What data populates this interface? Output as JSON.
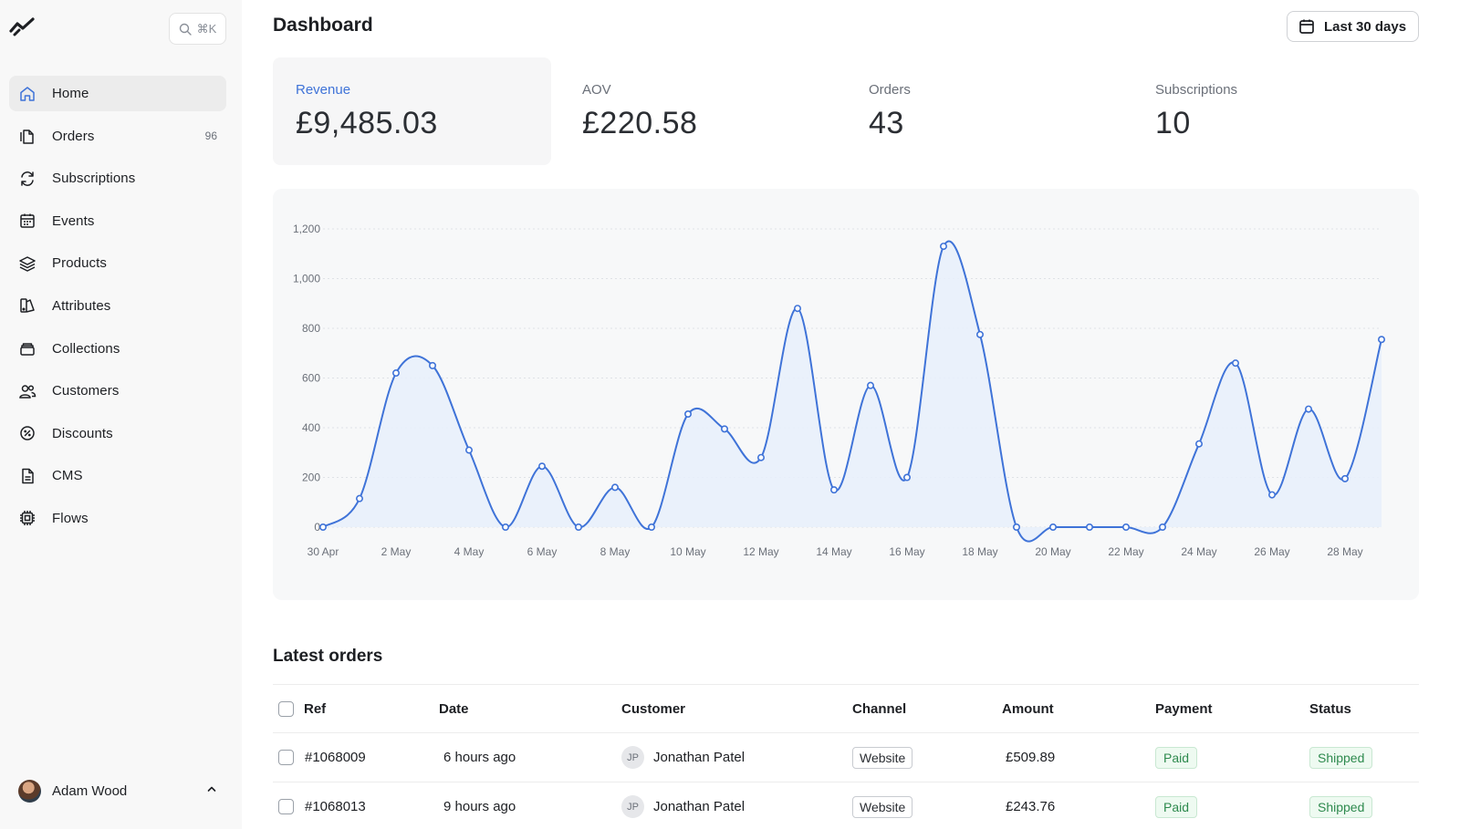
{
  "sidebar": {
    "search_shortcut": "⌘K",
    "items": [
      {
        "label": "Home",
        "icon": "home-icon",
        "active": true
      },
      {
        "label": "Orders",
        "icon": "orders-icon",
        "badge": "96"
      },
      {
        "label": "Subscriptions",
        "icon": "refresh-icon"
      },
      {
        "label": "Events",
        "icon": "calendar-icon"
      },
      {
        "label": "Products",
        "icon": "layers-icon"
      },
      {
        "label": "Attributes",
        "icon": "swatch-icon"
      },
      {
        "label": "Collections",
        "icon": "archive-icon"
      },
      {
        "label": "Customers",
        "icon": "users-icon"
      },
      {
        "label": "Discounts",
        "icon": "discount-icon"
      },
      {
        "label": "CMS",
        "icon": "document-icon"
      },
      {
        "label": "Flows",
        "icon": "chip-icon"
      }
    ],
    "user": {
      "name": "Adam Wood"
    }
  },
  "header": {
    "title": "Dashboard",
    "range_label": "Last 30 days"
  },
  "stats": [
    {
      "label": "Revenue",
      "value": "£9,485.03",
      "active": true
    },
    {
      "label": "AOV",
      "value": "£220.58"
    },
    {
      "label": "Orders",
      "value": "43"
    },
    {
      "label": "Subscriptions",
      "value": "10"
    }
  ],
  "accent_color": "#3f73d8",
  "chart_data": {
    "type": "area",
    "x": [
      "30 Apr",
      "1 May",
      "2 May",
      "3 May",
      "4 May",
      "5 May",
      "6 May",
      "7 May",
      "8 May",
      "9 May",
      "10 May",
      "11 May",
      "12 May",
      "13 May",
      "14 May",
      "15 May",
      "16 May",
      "17 May",
      "18 May",
      "19 May",
      "20 May",
      "21 May",
      "22 May",
      "23 May",
      "24 May",
      "25 May",
      "26 May",
      "27 May",
      "28 May",
      "29 May"
    ],
    "y": [
      0,
      115,
      620,
      650,
      310,
      0,
      245,
      0,
      160,
      0,
      455,
      395,
      280,
      880,
      150,
      570,
      200,
      1130,
      775,
      0,
      0,
      0,
      0,
      0,
      335,
      660,
      130,
      475,
      195,
      755
    ],
    "x_tick_labels": [
      "30 Apr",
      "2 May",
      "4 May",
      "6 May",
      "8 May",
      "10 May",
      "12 May",
      "14 May",
      "16 May",
      "18 May",
      "20 May",
      "22 May",
      "24 May",
      "26 May",
      "28 May"
    ],
    "y_ticks": [
      "0",
      "200",
      "400",
      "600",
      "800",
      "1,000",
      "1,200"
    ],
    "ylim": [
      0,
      1200
    ],
    "grid": true,
    "color": "#3f73d8"
  },
  "orders": {
    "title": "Latest orders",
    "columns": [
      "Ref",
      "Date",
      "Customer",
      "Channel",
      "Amount",
      "Payment",
      "Status"
    ],
    "rows": [
      {
        "ref": "#1068009",
        "date": "6 hours ago",
        "initials": "JP",
        "customer": "Jonathan Patel",
        "channel": "Website",
        "amount": "£509.89",
        "payment": "Paid",
        "status": "Shipped"
      },
      {
        "ref": "#1068013",
        "date": "9 hours ago",
        "initials": "JP",
        "customer": "Jonathan Patel",
        "channel": "Website",
        "amount": "£243.76",
        "payment": "Paid",
        "status": "Shipped"
      }
    ]
  }
}
